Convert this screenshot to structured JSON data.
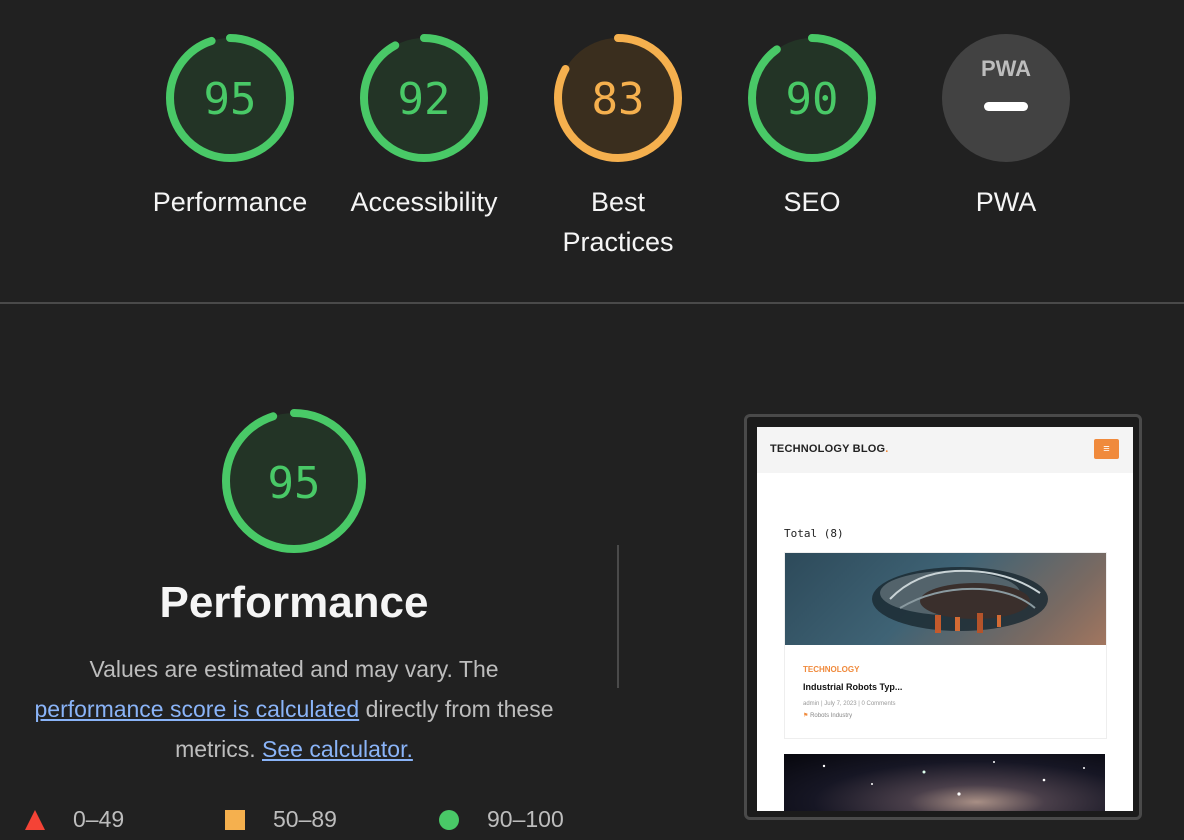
{
  "gauges": [
    {
      "label": "Performance",
      "score": "95",
      "value": 95,
      "color": "#49c967",
      "fill": "#233426"
    },
    {
      "label": "Accessibility",
      "score": "92",
      "value": 92,
      "color": "#49c967",
      "fill": "#233426"
    },
    {
      "label": "Best Practices",
      "score": "83",
      "value": 83,
      "color": "#f5b04e",
      "fill": "#3a2e1e"
    },
    {
      "label": "SEO",
      "score": "90",
      "value": 90,
      "color": "#49c967",
      "fill": "#233426"
    },
    {
      "label": "PWA",
      "badge": "PWA",
      "color": "#9e9e9e",
      "fill": "#424242"
    }
  ],
  "performance": {
    "score": "95",
    "value": 95,
    "title": "Performance",
    "desc_text_1": "Values are estimated and may vary. The",
    "desc_link_1": "performance score is calculated",
    "desc_text_2": "directly from these metrics.",
    "desc_link_2": "See calculator."
  },
  "legend": [
    {
      "shape": "triangle",
      "range": "0–49",
      "color": "#f44336"
    },
    {
      "shape": "square",
      "range": "50–89",
      "color": "#f5b04e"
    },
    {
      "shape": "circle",
      "range": "90–100",
      "color": "#49c967"
    }
  ],
  "screenshot": {
    "logo": "TECHNOLOGY BLOG",
    "logo_dot": ".",
    "menu_icon": "≡",
    "total": "Total (8)",
    "post": {
      "category": "TECHNOLOGY",
      "title": "Industrial Robots Typ...",
      "meta": "admin  |  July 7, 2023  |  0 Comments",
      "tag": "Robots Industry"
    }
  }
}
